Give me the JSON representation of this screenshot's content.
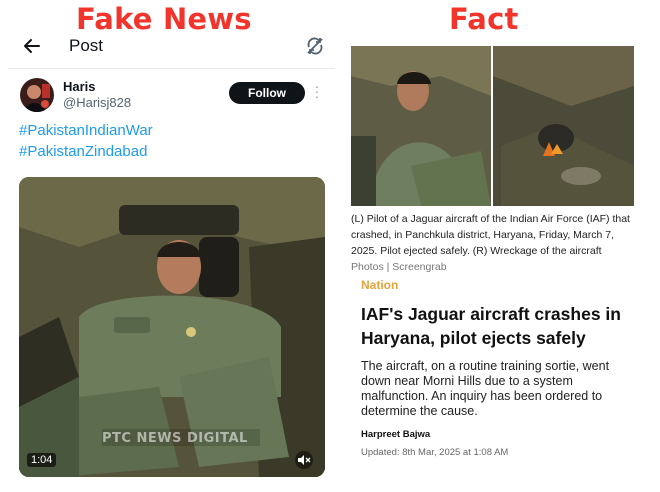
{
  "labels": {
    "left": "Fake News",
    "right": "Fact"
  },
  "post": {
    "title": "Post",
    "user": {
      "name": "Haris",
      "handle": "@Harisj828"
    },
    "follow_label": "Follow",
    "hashtags": [
      "#PakistanIndianWar",
      "#PakistanZindabad"
    ],
    "video": {
      "duration": "1:04",
      "watermark": "PTC NEWS DIGITAL"
    },
    "icons": {
      "back": "arrow-left-icon",
      "sync": "refresh-icon",
      "more": "more-vertical-icon",
      "mute": "volume-mute-icon"
    }
  },
  "article": {
    "caption_text": "(L) Pilot of a Jaguar aircraft of the Indian Air Force (IAF) that crashed, in Panchkula district, Haryana, Friday, March 7, 2025. Pilot ejected safely. (R) Wreckage of the aircraft",
    "caption_credit": "Photos | Screengrab",
    "section": "Nation",
    "headline": "IAF's Jaguar aircraft crashes in Haryana, pilot ejects safely",
    "summary": "The aircraft, on a routine training sortie, went down near Morni Hills due to a system malfunction. An inquiry has been ordered to determine the cause.",
    "author": "Harpreet Bajwa",
    "updated": "Updated: 8th Mar, 2025 at 1:08 AM"
  },
  "colors": {
    "label_red": "#f2352c",
    "link_blue": "#1d9bf0",
    "section_orange": "#e6a23c"
  }
}
